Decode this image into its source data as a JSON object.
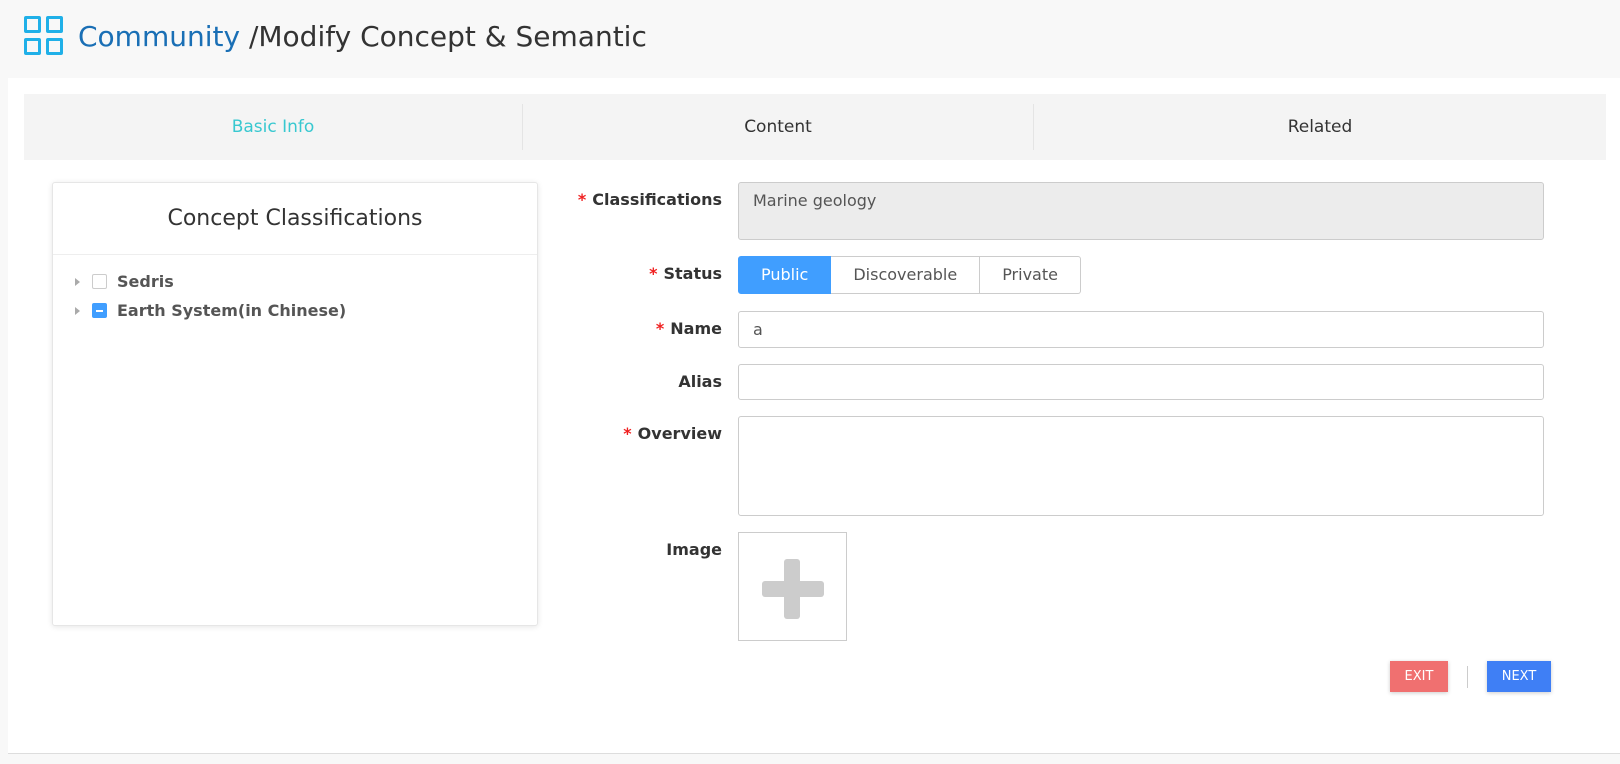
{
  "header": {
    "crumb": "Community",
    "title": " /Modify Concept & Semantic"
  },
  "tabs": [
    {
      "label": "Basic Info",
      "active": true
    },
    {
      "label": "Content",
      "active": false
    },
    {
      "label": "Related",
      "active": false
    }
  ],
  "classifications_panel": {
    "title": "Concept Classifications",
    "items": [
      {
        "label": "Sedris",
        "checked": "unchecked"
      },
      {
        "label": "Earth System(in Chinese)",
        "checked": "partial"
      }
    ]
  },
  "form": {
    "required_mark": "*",
    "classifications": {
      "label": "Classifications",
      "value": "Marine geology"
    },
    "status": {
      "label": "Status",
      "options": [
        "Public",
        "Discoverable",
        "Private"
      ],
      "selected": "Public"
    },
    "name": {
      "label": "Name",
      "value": "a"
    },
    "alias": {
      "label": "Alias",
      "value": ""
    },
    "overview": {
      "label": "Overview",
      "value": ""
    },
    "image": {
      "label": "Image",
      "icon": "plus-icon"
    }
  },
  "actions": {
    "exit_label": "EXIT",
    "next_label": "NEXT"
  },
  "colors": {
    "brand": "#20b0e8",
    "crumb": "#1a6fb5",
    "active_tab": "#38c8d0",
    "primary": "#409eff",
    "exit": "#f07070",
    "next": "#3f7ff5",
    "required": "#f02020"
  }
}
